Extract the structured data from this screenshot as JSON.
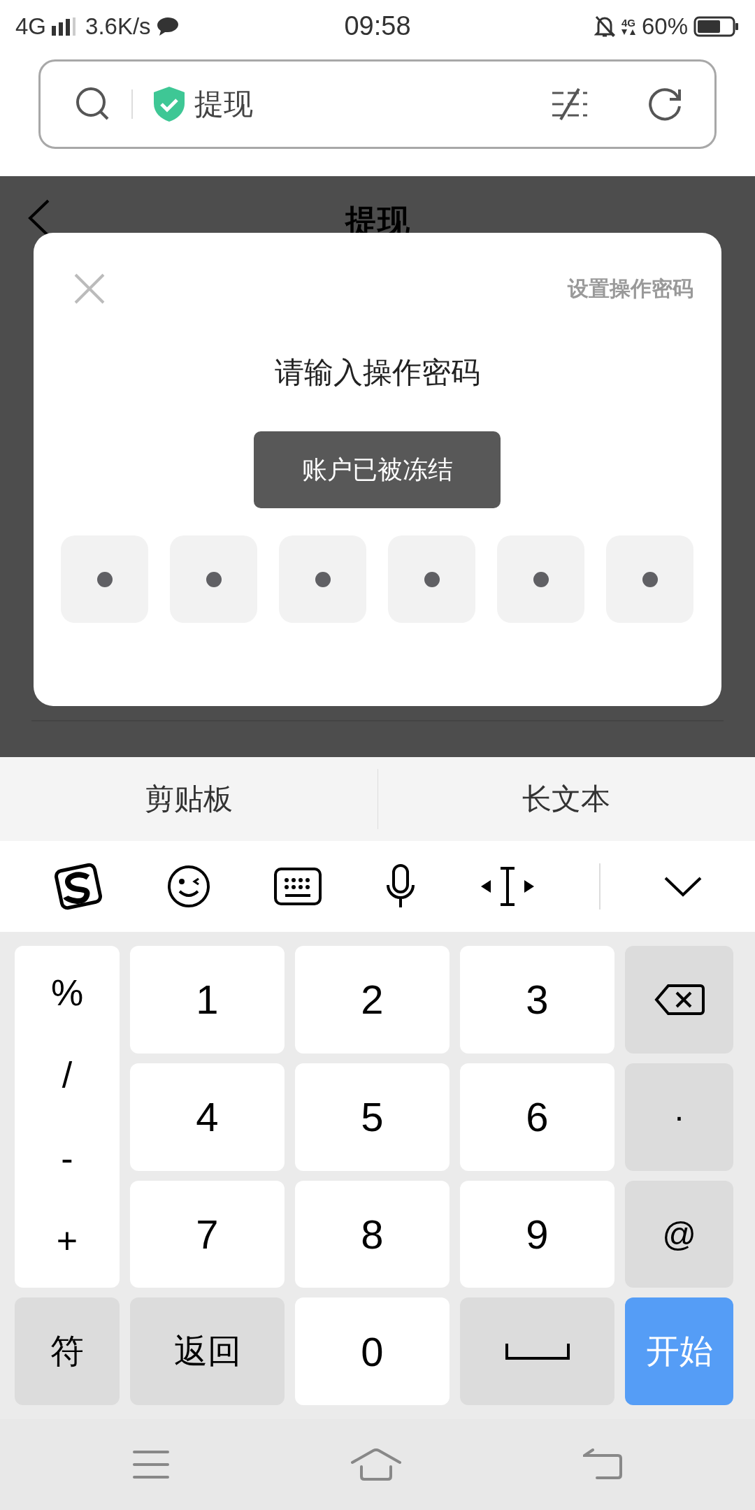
{
  "status_bar": {
    "network": "4G",
    "speed": "3.6K/s",
    "time": "09:58",
    "data_label": "4G",
    "battery": "60%"
  },
  "search_bar": {
    "title": "提现"
  },
  "page": {
    "title": "提现"
  },
  "dialog": {
    "link": "设置操作密码",
    "title": "请输入操作密码",
    "toast": "账户已被冻结",
    "pin": [
      {
        "filled": true
      },
      {
        "filled": true
      },
      {
        "filled": true
      },
      {
        "filled": true
      },
      {
        "filled": true
      },
      {
        "filled": true
      }
    ]
  },
  "keyboard": {
    "candidates": [
      "剪贴板",
      "长文本"
    ],
    "symbols": [
      "%",
      "/",
      "-",
      "+"
    ],
    "keys": [
      {
        "kind": "digit",
        "label": "1"
      },
      {
        "kind": "digit",
        "label": "2"
      },
      {
        "kind": "digit",
        "label": "3"
      },
      {
        "kind": "backspace"
      },
      {
        "kind": "digit",
        "label": "4"
      },
      {
        "kind": "digit",
        "label": "5"
      },
      {
        "kind": "digit",
        "label": "6"
      },
      {
        "kind": "function",
        "label": "·"
      },
      {
        "kind": "digit",
        "label": "7"
      },
      {
        "kind": "digit",
        "label": "8"
      },
      {
        "kind": "digit",
        "label": "9"
      },
      {
        "kind": "function",
        "label": "@"
      },
      {
        "kind": "function",
        "label": "符"
      },
      {
        "kind": "function",
        "label": "返回"
      },
      {
        "kind": "digit",
        "label": "0"
      },
      {
        "kind": "space"
      },
      {
        "kind": "action",
        "label": "开始"
      }
    ]
  }
}
